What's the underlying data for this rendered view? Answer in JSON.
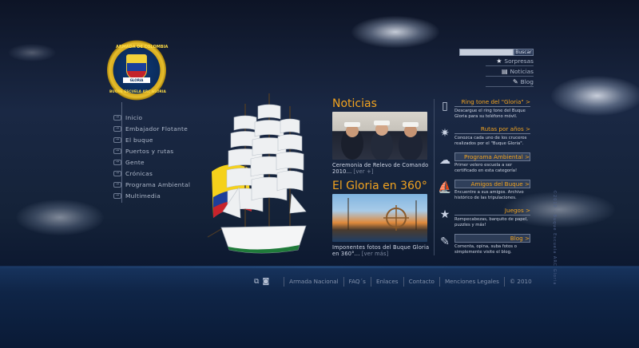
{
  "logo": {
    "ring_top": "ARMADA DE COLOMBIA",
    "ring_bottom": "BUQUE ESCUELA ARC GLORIA",
    "ribbon": "GLORIA"
  },
  "search": {
    "placeholder": "",
    "button": "Buscar"
  },
  "toplinks": [
    {
      "icon": "star-icon",
      "glyph": "★",
      "label": "Sorpresas"
    },
    {
      "icon": "newspaper-icon",
      "glyph": "▤",
      "label": "Noticias"
    },
    {
      "icon": "edit-icon",
      "glyph": "✎",
      "label": "Blog"
    }
  ],
  "leftnav": [
    {
      "label": "Inicio"
    },
    {
      "label": "Embajador Flotante"
    },
    {
      "label": "El buque"
    },
    {
      "label": "Puertos y rutas"
    },
    {
      "label": "Gente"
    },
    {
      "label": "Crónicas"
    },
    {
      "label": "Programa Ambiental"
    },
    {
      "label": "Multimedia"
    }
  ],
  "news": {
    "title": "Noticias",
    "caption1": "Ceremonia de Relevo de Comando 2010...",
    "more1": "[ver +]",
    "title2": "El Gloria en 360°",
    "caption2": "Imponentes fotos del Buque Gloria en 360°...",
    "more2": "[ver más]"
  },
  "right": [
    {
      "icon": "phone-icon",
      "glyph": "▯",
      "title": "Ring tone del \"Gloria\" >",
      "desc": "Descargue el ring tone del Buque Gloria para su teléfono móvil.",
      "boxed": false
    },
    {
      "icon": "compass-icon",
      "glyph": "✷",
      "title": "Rutas por años >",
      "desc": "Conozca cada uno de los cruceros realizados por el \"Buque Gloria\".",
      "boxed": false
    },
    {
      "icon": "cloud-icon",
      "glyph": "☁",
      "title": "Programa Ambiental >",
      "desc": "Primer velero escuela a ser certificado en esta categoría!",
      "boxed": true
    },
    {
      "icon": "ship-icon",
      "glyph": "⛵",
      "title": "Amigos del Buque >",
      "desc": "Encuentre a sus amigos. Archivo histórico de las tripulaciones.",
      "boxed": true
    },
    {
      "icon": "star-icon",
      "glyph": "★",
      "title": "Juegos >",
      "desc": "Rompecabezas, barquito de papel, puzzles y más!",
      "boxed": false
    },
    {
      "icon": "edit-icon",
      "glyph": "✎",
      "title": "Blog >",
      "desc": "Comenta, opina, suba fotos o simplemente visite el blog.",
      "boxed": true
    }
  ],
  "vertical_text": "©2010 · Buque Escuela ARC Gloria",
  "footer": {
    "links": [
      "Armada Nacional",
      "FAQ´s",
      "Enlaces",
      "Contacto",
      "Menciones Legales",
      "© 2010"
    ]
  },
  "colors": {
    "accent": "#f2a31f",
    "sky": "#1a2844",
    "sea": "#0f2547"
  }
}
